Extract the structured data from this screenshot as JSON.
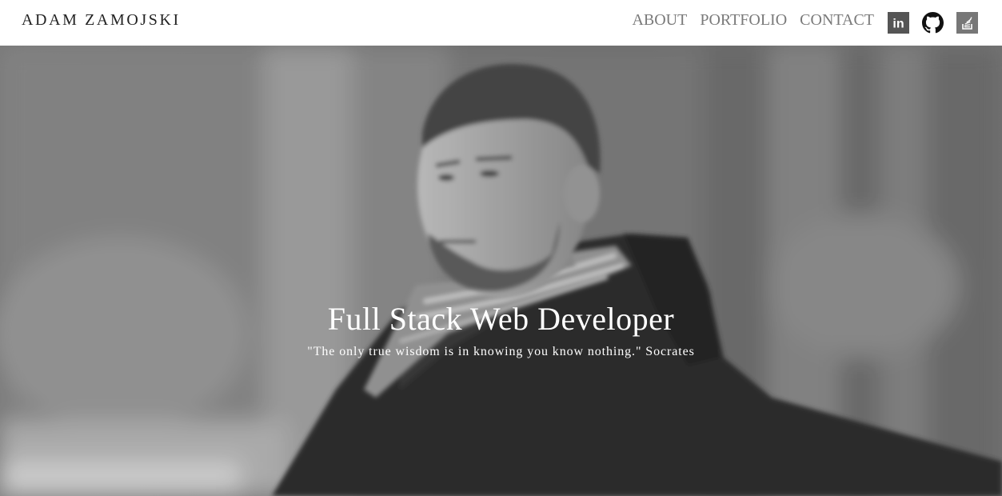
{
  "brand": {
    "name": "ADAM ZAMOJSKI"
  },
  "nav": {
    "items": [
      {
        "label": "ABOUT"
      },
      {
        "label": "PORTFOLIO"
      },
      {
        "label": "CONTACT"
      }
    ]
  },
  "social": {
    "icons": [
      {
        "icon": "linkedin-icon",
        "label": "in"
      },
      {
        "icon": "github-icon"
      },
      {
        "icon": "stackoverflow-icon"
      }
    ]
  },
  "hero": {
    "title": "Full Stack Web Developer",
    "quote": "\"The only true wisdom is in knowing you know nothing.\" Socrates"
  },
  "colors": {
    "nav_link": "#7a7a7a",
    "brand_text": "#222222",
    "hero_text": "#ffffff",
    "icon_bg": "#555555"
  }
}
